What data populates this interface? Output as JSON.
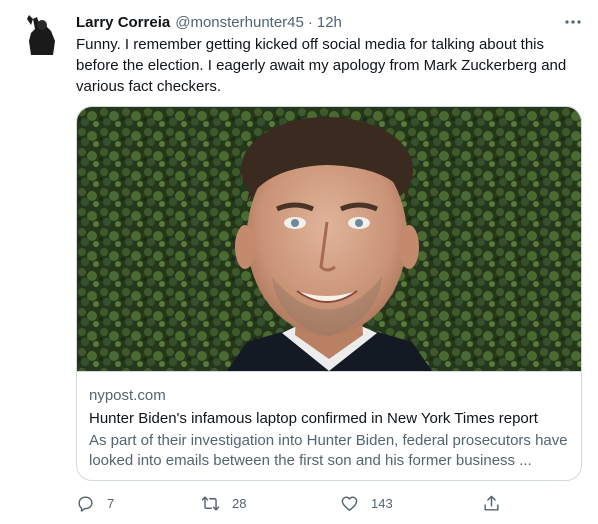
{
  "tweet": {
    "author_name": "Larry Correia",
    "author_handle": "@monsterhunter45",
    "separator": "·",
    "time": "12h",
    "text": "Funny. I remember getting kicked off social media for talking about this before the election. I eagerly await my apology from Mark Zuckerberg and various fact checkers.",
    "avatar_icon": "avatar-silhouette-icon"
  },
  "card": {
    "domain": "nypost.com",
    "title": "Hunter Biden's infamous laptop confirmed in New York Times report",
    "description": "As part of their investigation into Hunter Biden, federal prosecutors have looked into emails between the first son and his former business ..."
  },
  "actions": {
    "replies": "7",
    "retweets": "28",
    "likes": "143"
  },
  "colors": {
    "text_primary": "#0f1419",
    "text_secondary": "#536471",
    "border": "#cfd9de"
  }
}
